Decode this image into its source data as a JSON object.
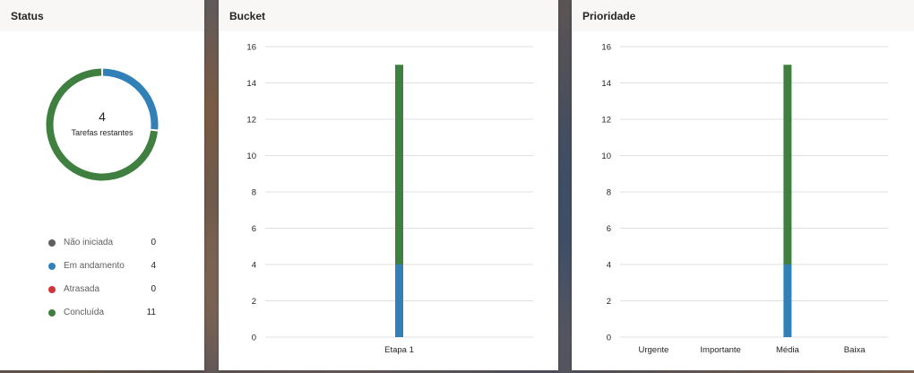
{
  "status_card": {
    "title": "Status",
    "remaining_count": "4",
    "remaining_label": "Tarefas restantes",
    "legend": [
      {
        "label": "Não iniciada",
        "count": "0",
        "color": "#605e5c"
      },
      {
        "label": "Em andamento",
        "count": "4",
        "color": "#3180b8"
      },
      {
        "label": "Atrasada",
        "count": "0",
        "color": "#d13438"
      },
      {
        "label": "Concluída",
        "count": "11",
        "color": "#3f7f3f"
      }
    ]
  },
  "bucket_card": {
    "title": "Bucket"
  },
  "priority_card": {
    "title": "Prioridade"
  },
  "chart_data": [
    {
      "type": "pie",
      "title": "Status",
      "categories": [
        "Não iniciada",
        "Em andamento",
        "Atrasada",
        "Concluída"
      ],
      "values": [
        0,
        4,
        0,
        11
      ],
      "colors": [
        "#605e5c",
        "#3180b8",
        "#d13438",
        "#3f7f3f"
      ],
      "center_value": "4",
      "center_label": "Tarefas restantes"
    },
    {
      "type": "bar",
      "stacked": true,
      "title": "Bucket",
      "categories": [
        "Etapa 1"
      ],
      "series": [
        {
          "values": [
            4
          ],
          "color": "#3180b8"
        },
        {
          "values": [
            11
          ],
          "color": "#3f7f3f"
        }
      ],
      "ylim": [
        0,
        16
      ],
      "yticks": [
        0,
        2,
        4,
        6,
        8,
        10,
        12,
        14,
        16
      ],
      "grid": true
    },
    {
      "type": "bar",
      "stacked": true,
      "title": "Prioridade",
      "categories": [
        "Urgente",
        "Importante",
        "Média",
        "Baixa"
      ],
      "series": [
        {
          "values": [
            0,
            0,
            4,
            0
          ],
          "color": "#3180b8"
        },
        {
          "values": [
            0,
            0,
            11,
            0
          ],
          "color": "#3f7f3f"
        }
      ],
      "ylim": [
        0,
        16
      ],
      "yticks": [
        0,
        2,
        4,
        6,
        8,
        10,
        12,
        14,
        16
      ],
      "grid": true
    }
  ]
}
